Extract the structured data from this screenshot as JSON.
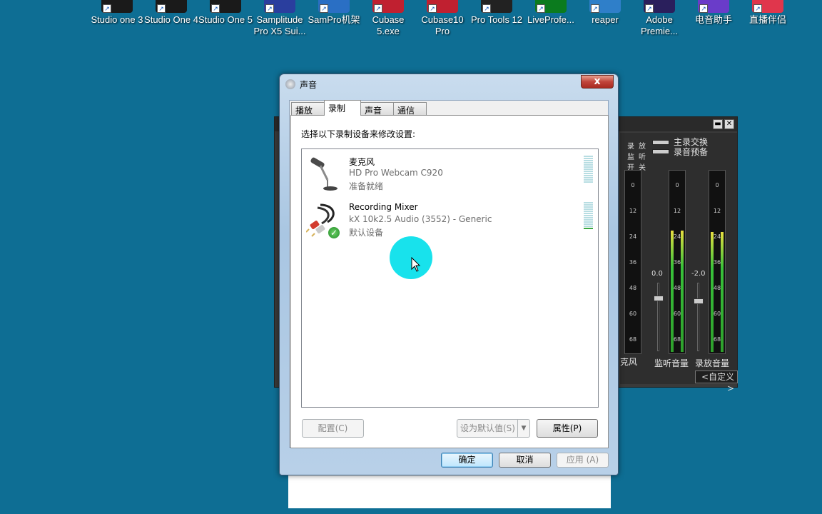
{
  "desktop": {
    "icons": [
      {
        "label": "Studio one 3",
        "color": "#1a1a1a"
      },
      {
        "label": "Studio One 4",
        "color": "#1a1a1a"
      },
      {
        "label": "Studio One 5",
        "color": "#1a1a1a"
      },
      {
        "label": "Samplitude Pro X5 Sui...",
        "color": "#2a3e9e"
      },
      {
        "label": "SamPro机架",
        "color": "#2a6fc4"
      },
      {
        "label": "Cubase 5.exe",
        "color": "#c02030"
      },
      {
        "label": "Cubase10 Pro",
        "color": "#c02030"
      },
      {
        "label": "Pro Tools 12",
        "color": "#222222"
      },
      {
        "label": "LiveProfe...",
        "color": "#0b7b1e"
      },
      {
        "label": "reaper",
        "color": "#2f7fc9"
      },
      {
        "label": "Adobe Premie...",
        "color": "#2a1f5c"
      },
      {
        "label": "电音助手",
        "color": "#6a3cc9"
      },
      {
        "label": "直播伴侣",
        "color": "#e0364c"
      }
    ]
  },
  "mixer": {
    "minimize_glyph": "▬",
    "close_glyph": "✕",
    "record_vertical": [
      "录",
      "监",
      "开"
    ],
    "playback_vertical": [
      "放",
      "听",
      "关"
    ],
    "switch1_label": "主录交换",
    "switch2_label": "录音预备",
    "meter_ticks": [
      "0",
      "12",
      "24",
      "36",
      "48",
      "60",
      "68"
    ],
    "fader1_value": "0.0",
    "fader2_value": "-2.0",
    "mic_label_partial": "克风",
    "monitor_label": "监听音量",
    "playback_label": "录放音量",
    "custom_button": "<自定义>",
    "monitor_level": 0.68,
    "playback_level": 0.67
  },
  "dialog": {
    "title": "声音",
    "close_glyph": "x",
    "tabs": [
      "播放",
      "录制",
      "声音",
      "通信"
    ],
    "active_tab": "录制",
    "instruction": "选择以下录制设备来修改设置:",
    "devices": [
      {
        "name": "麦克风",
        "subtitle": "HD Pro Webcam C920",
        "status": "准备就绪",
        "icon": "microphone-icon",
        "level": 0
      },
      {
        "name": "Recording Mixer",
        "subtitle": "kX 10k2.5 Audio (3552) - Generic",
        "status": "默认设备",
        "icon": "rca-cable-icon",
        "level": 1
      }
    ],
    "buttons": {
      "configure": "配置(C)",
      "set_default": "设为默认值(S)",
      "properties": "属性(P)",
      "ok": "确定",
      "cancel": "取消",
      "apply": "应用 (A)"
    }
  }
}
